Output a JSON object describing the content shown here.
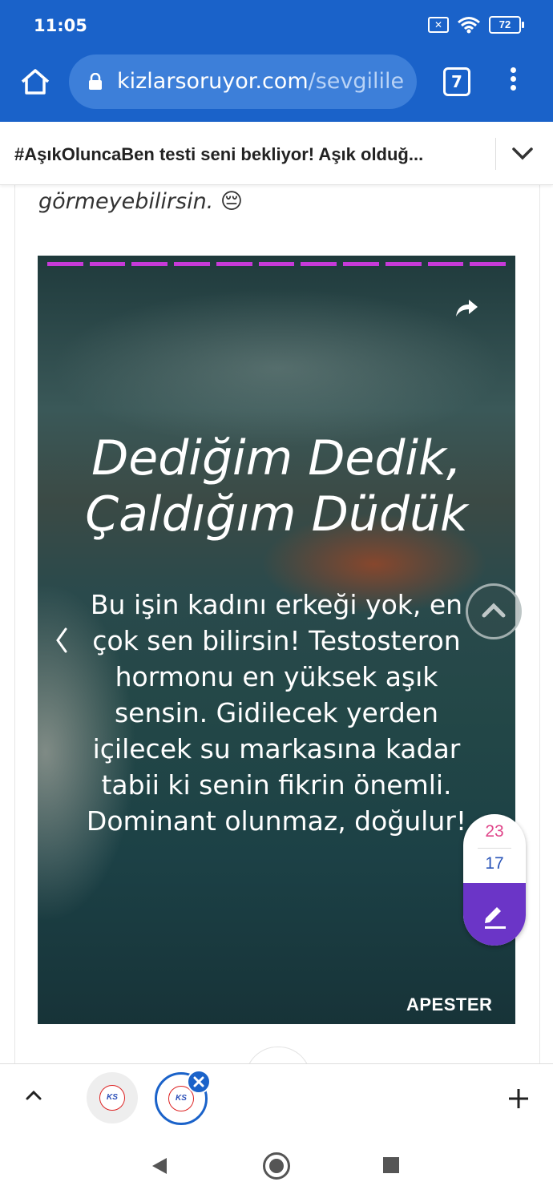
{
  "status": {
    "time": "11:05",
    "battery": "72"
  },
  "browser": {
    "url_domain": "kizlarsoruyor.com",
    "url_path": "/sevgililer-g",
    "tab_count": "7"
  },
  "article": {
    "title": "#AşıkOluncaBen testi seni bekliyor! Aşık olduğ...",
    "lead_text": "görmeyebilirsin. 😔"
  },
  "story": {
    "progress_segments": 11,
    "title_line1": "Dediğim Dedik,",
    "title_line2": "Çaldığım Düdük",
    "body": "Bu işin kadını erkeği yok, en çok sen bilirsin! Testosteron hormonu en yüksek aşık sensin. Gidilecek yerden içilecek su markasına kadar tabii ki senin fikrin önemli. Dominant olunmaz, doğulur!",
    "brand": "APESTER",
    "accent_color": "#c63ad8"
  },
  "vote_widget": {
    "count_top": "23",
    "count_bottom": "17"
  },
  "tab_group": {
    "tab_favicon": "KS"
  },
  "icons": [
    "home-icon",
    "lock-icon",
    "menu-icon",
    "chevron-down-icon",
    "share-icon",
    "chevron-left-icon",
    "chevron-up-icon",
    "pencil-icon",
    "close-icon",
    "plus-icon",
    "back-icon",
    "home-circle-icon",
    "recents-icon"
  ]
}
